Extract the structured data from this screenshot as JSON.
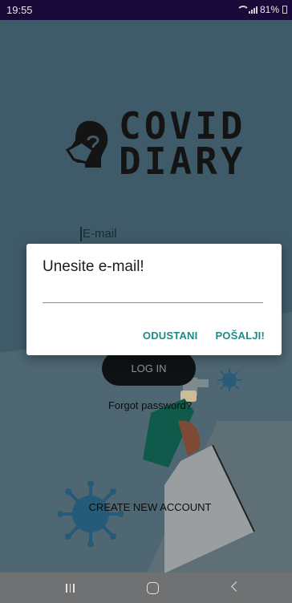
{
  "status_bar": {
    "time": "19:55",
    "battery": "81%"
  },
  "app": {
    "logo_line1": "COVID",
    "logo_line2": "DIARY",
    "email_placeholder": "E-mail",
    "login_label": "LOG IN",
    "forgot_label": "Forgot password?",
    "create_label": "CREATE NEW ACCOUNT"
  },
  "dialog": {
    "title": "Unesite e-mail!",
    "input_value": "",
    "cancel_label": "ODUSTANI",
    "send_label": "POŠALJI!"
  },
  "colors": {
    "accent": "#1f8a85",
    "dialog_bg": "#ffffff",
    "scrim_bg": "#3f5b69"
  },
  "icons": {
    "logo": "masked-head-icon",
    "nav": [
      "recents-icon",
      "home-icon",
      "back-icon"
    ]
  }
}
